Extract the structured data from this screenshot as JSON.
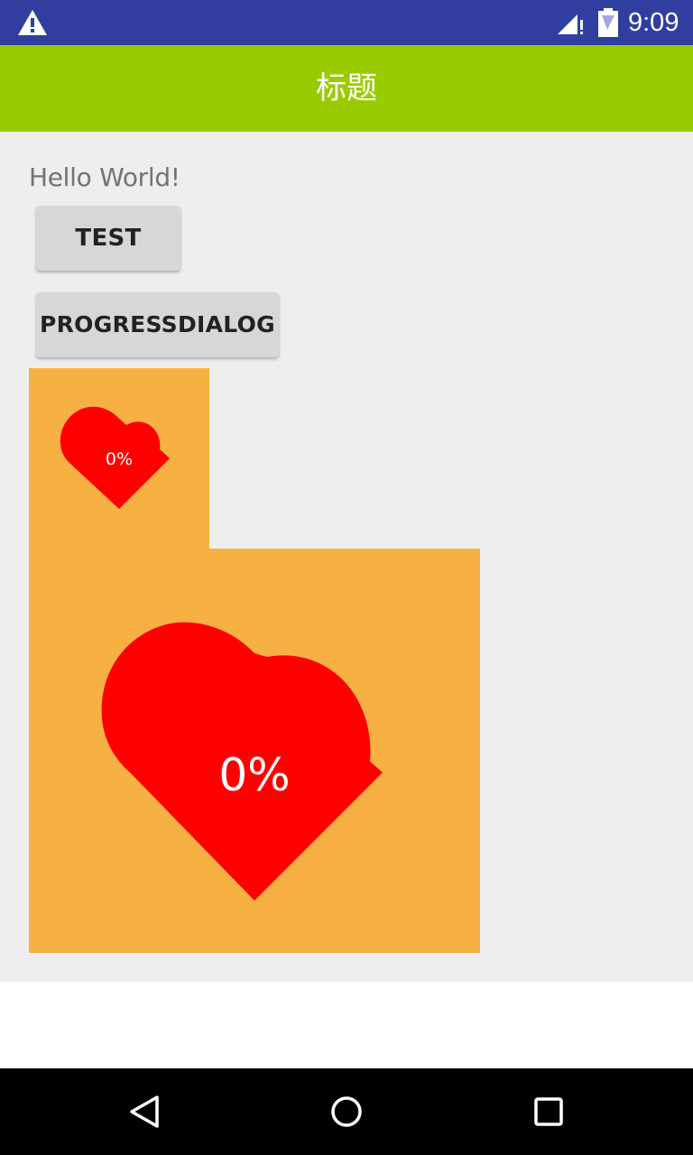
{
  "status_bar": {
    "time": "9:09",
    "icons": [
      "warning-icon",
      "cell-signal-icon",
      "battery-icon"
    ],
    "background": "#303f9f"
  },
  "action_bar": {
    "title": "标题",
    "background": "#99cc00"
  },
  "main": {
    "hello_text": "Hello World!",
    "buttons": [
      {
        "label": "TEST"
      },
      {
        "label": "PROGRESSDIALOG"
      }
    ],
    "progress_small": {
      "percent_label": "0%",
      "value": 0
    },
    "progress_large": {
      "percent_label": "0%",
      "value": 0
    },
    "colors": {
      "panel": "#f7b042",
      "heart": "#ff0000",
      "background": "#eeeeee"
    }
  },
  "nav_bar": {
    "icons": [
      "back-icon",
      "home-icon",
      "recents-icon"
    ]
  }
}
